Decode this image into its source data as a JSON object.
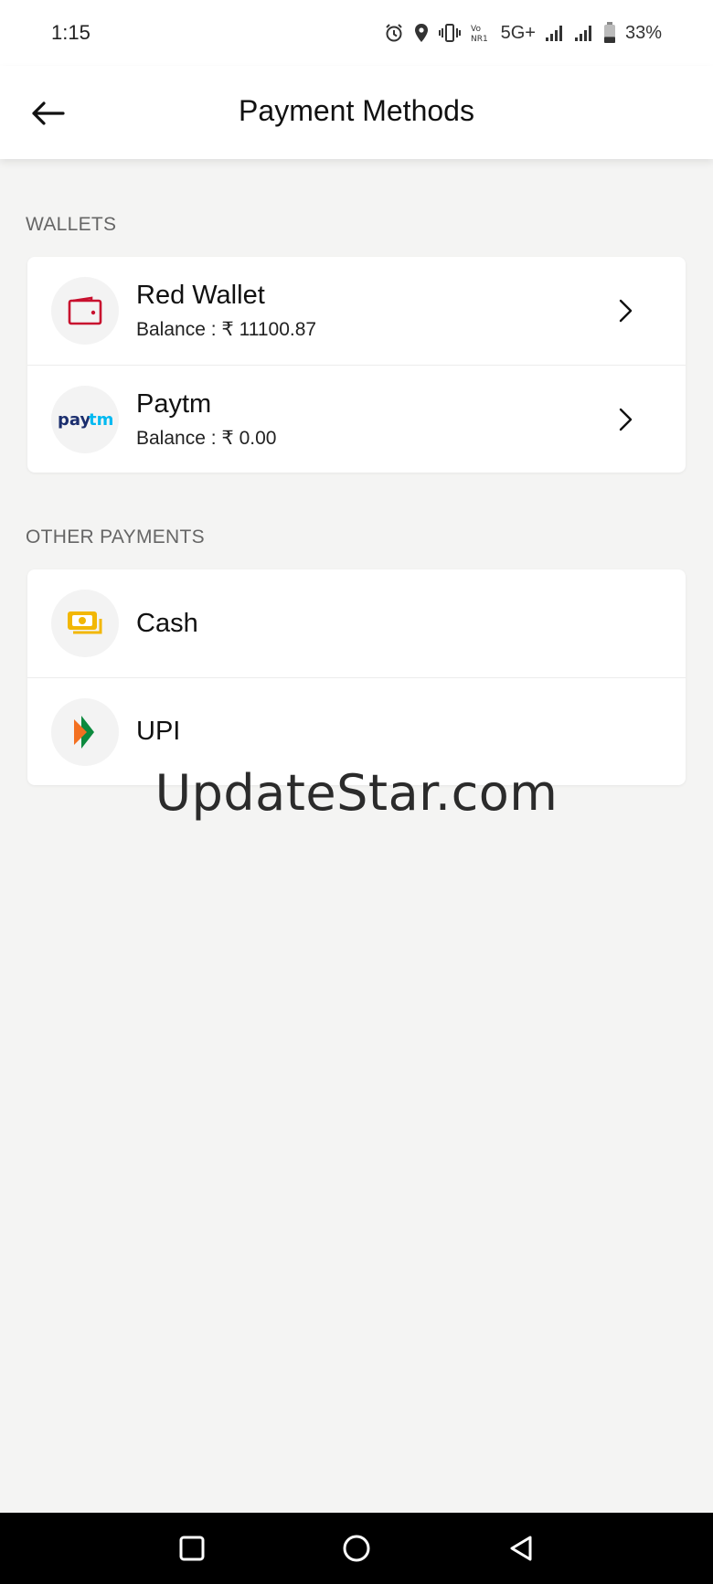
{
  "status_bar": {
    "time": "1:15",
    "network_label": "5G+",
    "volte_label": "Vo NR1",
    "battery_percent": "33%",
    "battery_level": 0.33,
    "icons": [
      "alarm-icon",
      "location-icon",
      "vibrate-icon",
      "volte-icon",
      "signal-icon",
      "signal-icon",
      "battery-icon"
    ]
  },
  "header": {
    "title": "Payment Methods",
    "back_icon": "arrow-left-icon"
  },
  "wallets": {
    "section_title": "WALLETS",
    "items": [
      {
        "name": "Red Wallet",
        "balance": "Balance : ₹ 11100.87",
        "icon": "wallet-icon",
        "accent": "#c8102e"
      },
      {
        "name": "Paytm",
        "balance": "Balance : ₹ 0.00",
        "icon": "paytm-logo",
        "logo_text_left": "pay",
        "logo_text_right": "tm"
      }
    ]
  },
  "other_payments": {
    "section_title": "OTHER PAYMENTS",
    "items": [
      {
        "name": "Cash",
        "icon": "cash-icon",
        "accent": "#f2b705"
      },
      {
        "name": "UPI",
        "icon": "upi-logo"
      }
    ]
  },
  "watermark": "UpdateStar.com",
  "nav": {
    "icons": [
      "recents-square-icon",
      "home-circle-icon",
      "back-triangle-icon"
    ]
  }
}
